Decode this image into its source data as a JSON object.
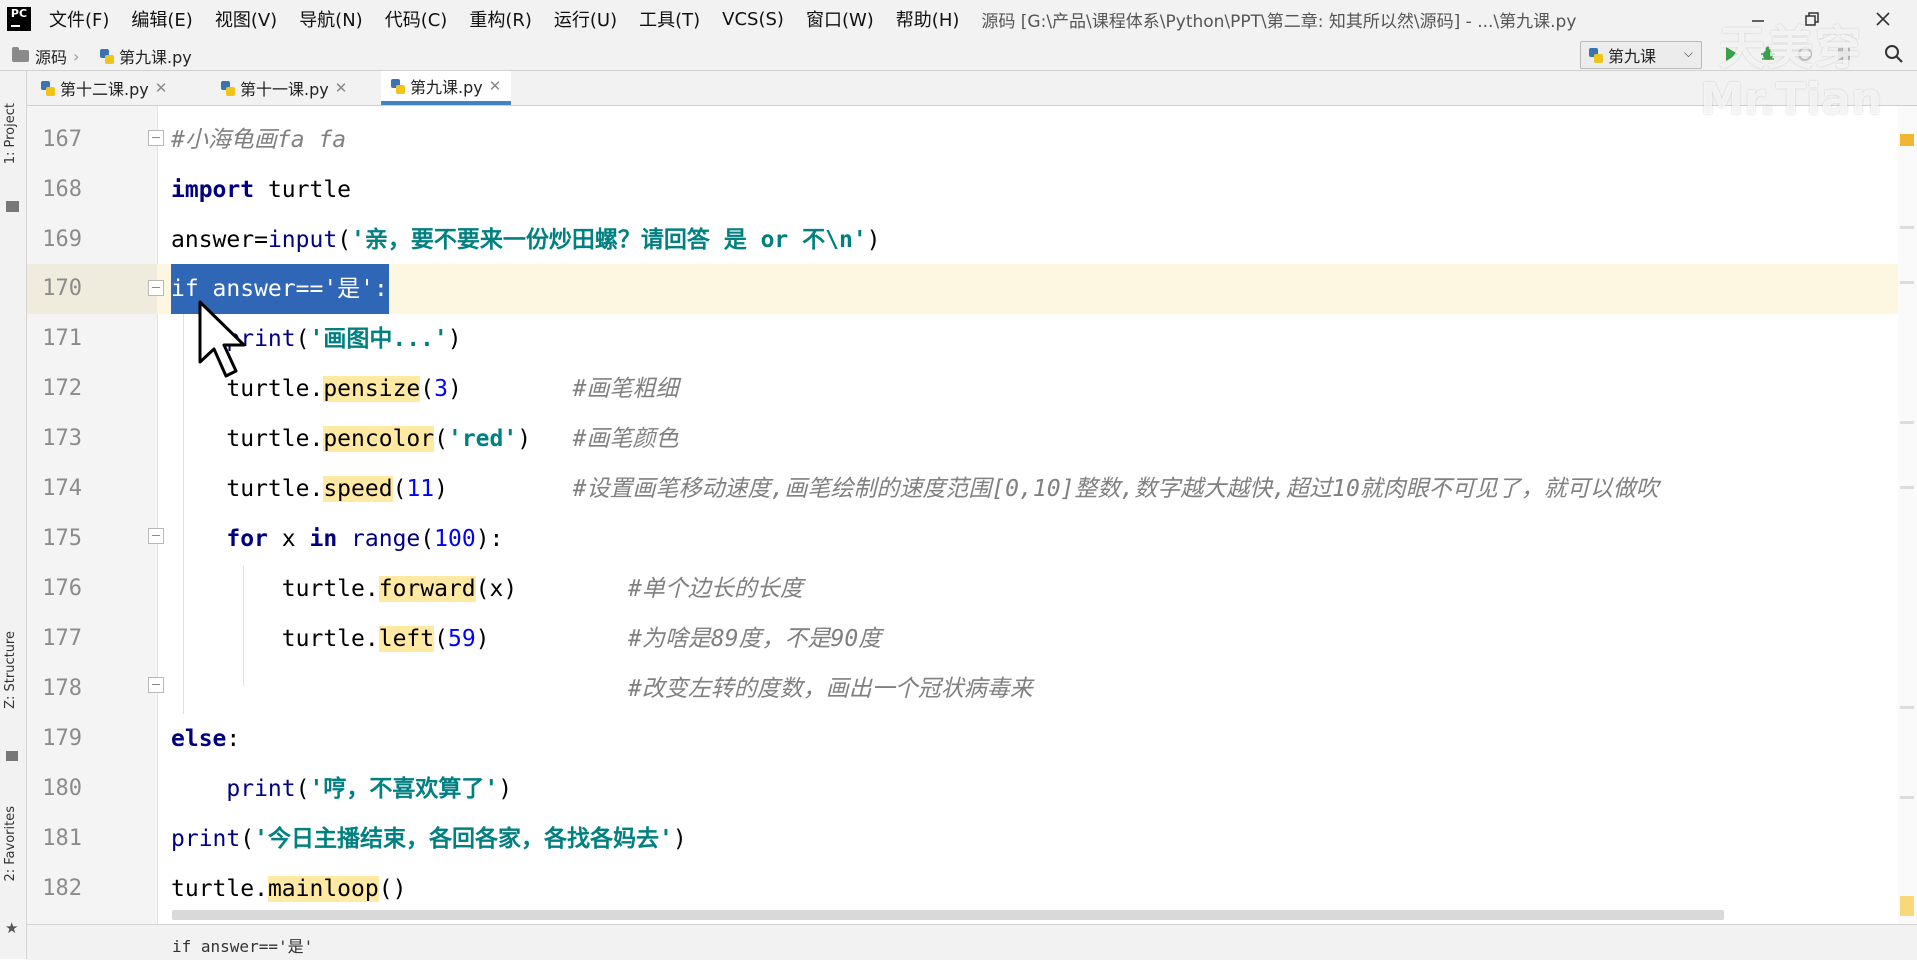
{
  "app": {
    "logo": "PC",
    "menus": [
      "文件(F)",
      "编辑(E)",
      "视图(V)",
      "导航(N)",
      "代码(C)",
      "重构(R)",
      "运行(U)",
      "工具(T)",
      "VCS(S)",
      "窗口(W)",
      "帮助(H)"
    ],
    "window_title": "源码 [G:\\产品\\课程体系\\Python\\PPT\\第二章: 知其所以然\\源码] - ...\\第九课.py",
    "window_controls": [
      "minimize-icon",
      "restore-icon",
      "close-icon"
    ]
  },
  "navbar": {
    "breadcrumb": [
      "源码",
      "第九课.py"
    ],
    "run_config": "第九课",
    "tool_icons": [
      "run-icon",
      "debug-icon",
      "rerun-icon",
      "stop-icon",
      "search-icon"
    ]
  },
  "tabs": [
    {
      "label": "第十二课.py",
      "active": false
    },
    {
      "label": "第十一课.py",
      "active": false
    },
    {
      "label": "第九课.py",
      "active": true
    }
  ],
  "side_panels": {
    "project": "1: Project",
    "structure": "Z: Structure",
    "favorites": "2: Favorites"
  },
  "editor": {
    "lines": [
      {
        "number": "167",
        "text": "#小海龟画fa fa"
      },
      {
        "number": "168",
        "text": "import turtle"
      },
      {
        "number": "169",
        "text": "answer=input('亲，要不要来一份炒田螺？请回答 是 or 不\\n')"
      },
      {
        "number": "170",
        "text": "if answer=='是':"
      },
      {
        "number": "171",
        "text": "    print('画图中...')"
      },
      {
        "number": "172",
        "text": "    turtle.pensize(3)        #画笔粗细"
      },
      {
        "number": "173",
        "text": "    turtle.pencolor('red')   #画笔颜色"
      },
      {
        "number": "174",
        "text": "    turtle.speed(11)         #设置画笔移动速度,画笔绘制的速度范围[0,10]整数,数字越大越快,超过10就肉眼不可见了，就可以做吹"
      },
      {
        "number": "175",
        "text": "    for x in range(100):"
      },
      {
        "number": "176",
        "text": "        turtle.forward(x)        #单个边长的长度"
      },
      {
        "number": "177",
        "text": "        turtle.left(59)          #为啥是89度，不是90度"
      },
      {
        "number": "178",
        "text": "                                 #改变左转的度数，画出一个冠状病毒来"
      },
      {
        "number": "179",
        "text": "else:"
      },
      {
        "number": "180",
        "text": "    print('哼，不喜欢算了')"
      },
      {
        "number": "181",
        "text": "print('今日主播结束，各回各家，各找各妈去')"
      },
      {
        "number": "182",
        "text": "turtle.mainloop()"
      }
    ],
    "selected_line": "170",
    "selection_text": "if answer=='是':"
  },
  "status": {
    "breadcrumb_text": "if answer=='是'"
  },
  "watermark": {
    "line1": "天美穿",
    "line2": "Mr.Tian"
  },
  "colors": {
    "keyword": "#000080",
    "string": "#008080",
    "number": "#0000ff",
    "comment": "#808080",
    "usage_highlight": "#ffe9a3",
    "selection": "#2f66b5",
    "active_tab_underline": "#4083c9"
  }
}
